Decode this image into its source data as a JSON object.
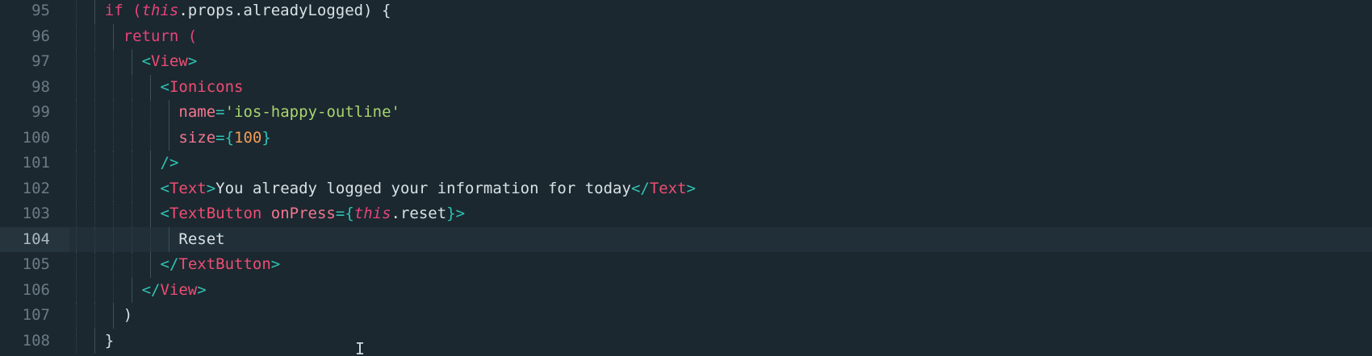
{
  "editor": {
    "lines": [
      {
        "number": "95",
        "tokens": [
          {
            "t": "if (",
            "c": "kw"
          },
          {
            "t": "this",
            "c": "this"
          },
          {
            "t": ".props.alreadyLogged) {",
            "c": "plain"
          }
        ]
      },
      {
        "number": "96",
        "tokens": [
          {
            "t": "return (",
            "c": "kw"
          }
        ]
      },
      {
        "number": "97",
        "tokens": [
          {
            "t": "<",
            "c": "punct"
          },
          {
            "t": "View",
            "c": "tag"
          },
          {
            "t": ">",
            "c": "punct"
          }
        ]
      },
      {
        "number": "98",
        "tokens": [
          {
            "t": "<",
            "c": "punct"
          },
          {
            "t": "Ionicons",
            "c": "tag"
          }
        ]
      },
      {
        "number": "99",
        "tokens": [
          {
            "t": "name",
            "c": "attr"
          },
          {
            "t": "=",
            "c": "punct"
          },
          {
            "t": "'ios-happy-outline'",
            "c": "str"
          }
        ]
      },
      {
        "number": "100",
        "tokens": [
          {
            "t": "size",
            "c": "attr"
          },
          {
            "t": "={",
            "c": "punct"
          },
          {
            "t": "100",
            "c": "num"
          },
          {
            "t": "}",
            "c": "punct"
          }
        ]
      },
      {
        "number": "101",
        "tokens": [
          {
            "t": "/>",
            "c": "punct"
          }
        ]
      },
      {
        "number": "102",
        "tokens": [
          {
            "t": "<",
            "c": "punct"
          },
          {
            "t": "Text",
            "c": "tag"
          },
          {
            "t": ">",
            "c": "punct"
          },
          {
            "t": "You already logged your information for today",
            "c": "plain"
          },
          {
            "t": "</",
            "c": "punct"
          },
          {
            "t": "Text",
            "c": "tag"
          },
          {
            "t": ">",
            "c": "punct"
          }
        ]
      },
      {
        "number": "103",
        "tokens": [
          {
            "t": "<",
            "c": "punct"
          },
          {
            "t": "TextButton",
            "c": "tag"
          },
          {
            "t": " ",
            "c": "plain"
          },
          {
            "t": "onPress",
            "c": "attr"
          },
          {
            "t": "={",
            "c": "punct"
          },
          {
            "t": "this",
            "c": "this"
          },
          {
            "t": ".reset",
            "c": "plain"
          },
          {
            "t": "}>",
            "c": "punct"
          }
        ]
      },
      {
        "number": "104",
        "active": true,
        "tokens": [
          {
            "t": "Reset",
            "c": "plain"
          }
        ]
      },
      {
        "number": "105",
        "tokens": [
          {
            "t": "</",
            "c": "punct"
          },
          {
            "t": "TextButton",
            "c": "tag"
          },
          {
            "t": ">",
            "c": "punct"
          }
        ]
      },
      {
        "number": "106",
        "tokens": [
          {
            "t": "</",
            "c": "punct"
          },
          {
            "t": "View",
            "c": "tag"
          },
          {
            "t": ">",
            "c": "punct"
          }
        ]
      },
      {
        "number": "107",
        "tokens": [
          {
            "t": ")",
            "c": "plain"
          }
        ]
      },
      {
        "number": "108",
        "tokens": [
          {
            "t": "}",
            "c": "plain"
          }
        ]
      }
    ]
  }
}
